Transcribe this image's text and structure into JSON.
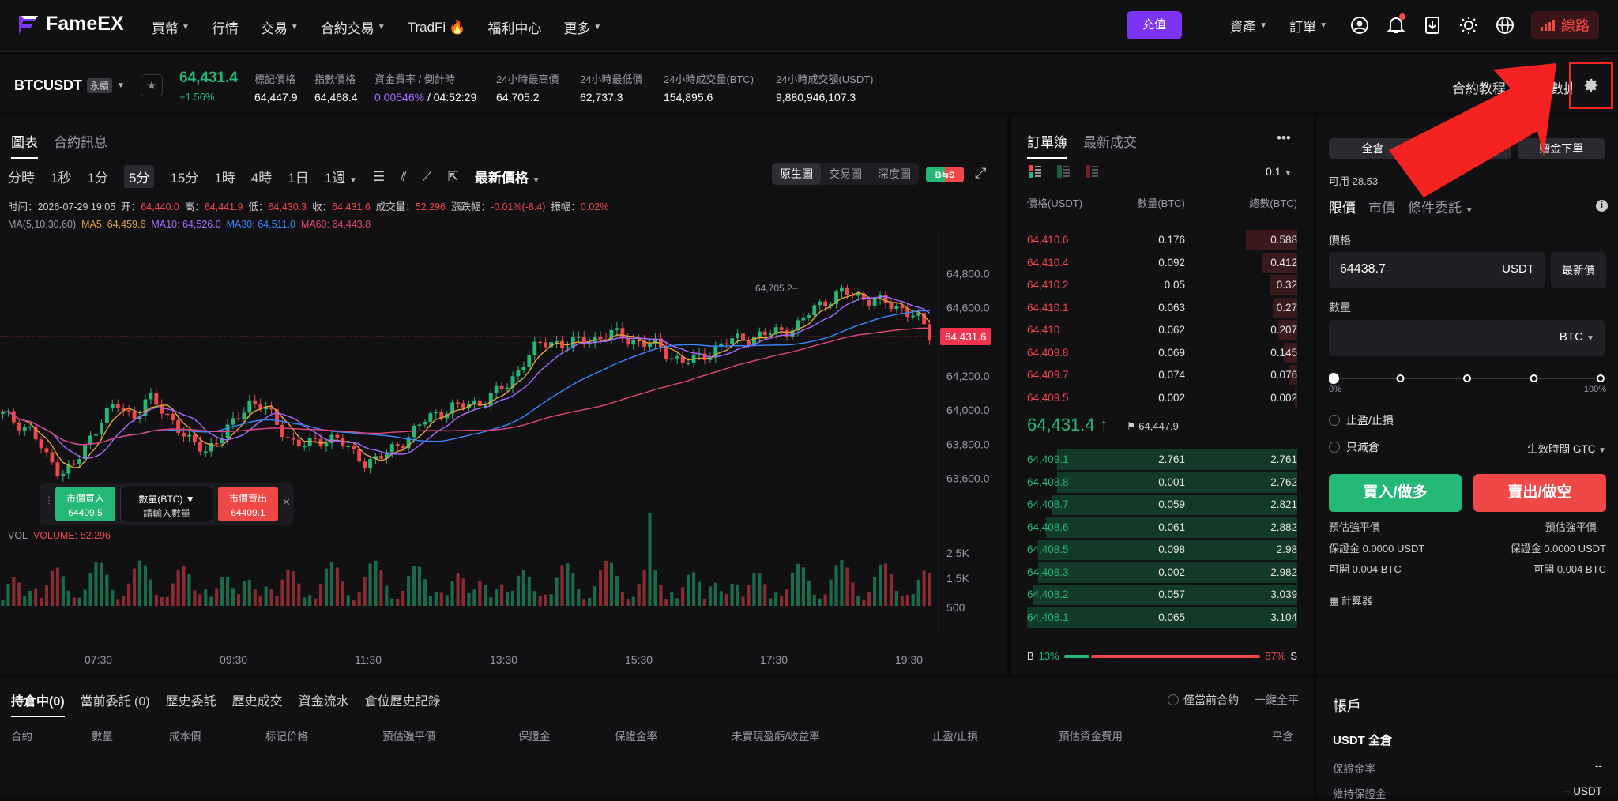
{
  "brand": {
    "name": "FameEX"
  },
  "nav": {
    "items": [
      "買幣",
      "行情",
      "交易",
      "合約交易",
      "TradFi",
      "福利中心",
      "更多"
    ]
  },
  "topbar": {
    "deposit": "充值",
    "assets": "資產",
    "orders": "訂單",
    "route": "線路"
  },
  "ticker": {
    "symbol": "BTCUSDT",
    "tag": "永續",
    "last": "64,431.4",
    "change": "+1.56%",
    "stats": [
      {
        "label": "標記價格",
        "value": "64,447.9"
      },
      {
        "label": "指數價格",
        "value": "64,468.4"
      },
      {
        "label": "資金費率 / 倒計時",
        "value_a": "0.00546%",
        "value_b": " / 04:52:29"
      },
      {
        "label": "24小時最高價",
        "value": "64,705.2"
      },
      {
        "label": "24小時最低價",
        "value": "62,737.3"
      },
      {
        "label": "24小時成交量(BTC)",
        "value": "154,895.6"
      },
      {
        "label": "24小時成交額(USDT)",
        "value": "9,880,946,107.3"
      }
    ],
    "right_links": [
      "合約教程",
      "合約數據"
    ]
  },
  "chart_panel": {
    "tabs": [
      "圖表",
      "合約訊息"
    ],
    "intervals": [
      "分時",
      "1秒",
      "1分",
      "5分",
      "15分",
      "1時",
      "4時",
      "1日",
      "1週"
    ],
    "price_type": "最新價格",
    "views": [
      "原生圖",
      "交易圖",
      "深度圖"
    ],
    "bs_badge": "B⇆S",
    "info": {
      "time_label": "时间：",
      "time": "2026-07-29 19:05",
      "open_label": "开：",
      "open": "64,440.0",
      "high_label": "高：",
      "high": "64,441.9",
      "low_label": "低：",
      "low": "64,430.3",
      "close_label": "收：",
      "close": "64,431.6",
      "vol_label": "成交量：",
      "vol": "52.296",
      "chg_label": "漲跌幅：",
      "chg": "-0.01%(-8.4)",
      "amp_label": "振幅：",
      "amp": "0.02%"
    },
    "ma": {
      "title": "MA(5,10,30,60)",
      "ma5": "MA5: 64,459.6",
      "ma10": "MA10: 64,526.0",
      "ma30": "MA30: 64,511.0",
      "ma60": "MA60: 64,443.8"
    },
    "vol_title": "VOL",
    "vol_value": "VOLUME: 52.296",
    "quick_trade": {
      "buy_label": "市價買入",
      "buy_price": "64409.5",
      "qty_label": "數量(BTC)",
      "qty_placeholder": "請輸入數量",
      "sell_label": "市價賣出",
      "sell_price": "64409.1"
    }
  },
  "chart_data": {
    "type": "candlestick",
    "x_ticks": [
      "07:30",
      "09:30",
      "11:30",
      "13:30",
      "15:30",
      "17:30",
      "19:30"
    ],
    "y_ticks": [
      64800.0,
      64600.0,
      64200.0,
      64000.0,
      63800.0,
      63600.0
    ],
    "y_tick_labels": [
      "64,800.0",
      "64,600.0",
      "64,200.0",
      "64,000.0",
      "63,800.0",
      "63,600.0"
    ],
    "ylim": [
      63500,
      64900
    ],
    "last_price": 64431.6,
    "last_price_label": "64,431.6",
    "high_marker": {
      "label": "64,705.2",
      "value": 64705.2
    },
    "close_path": [
      63970,
      63930,
      63880,
      63720,
      63640,
      63680,
      63820,
      63990,
      64020,
      63950,
      64080,
      63990,
      63920,
      63800,
      63760,
      63850,
      63920,
      64050,
      64030,
      63900,
      63820,
      63790,
      63820,
      63850,
      63750,
      63700,
      63720,
      63770,
      63850,
      63930,
      63980,
      64020,
      64020,
      64050,
      64100,
      64150,
      64300,
      64380,
      64400,
      64390,
      64400,
      64420,
      64450,
      64420,
      64400,
      64380,
      64330,
      64280,
      64300,
      64350,
      64400,
      64420,
      64430,
      64450,
      64470,
      64500,
      64600,
      64650,
      64690,
      64670,
      64650,
      64620,
      64600,
      64560,
      64431
    ],
    "vol_ticks": [
      "2.5K",
      "1.5K",
      "500"
    ]
  },
  "orderbook": {
    "tabs": [
      "訂單簿",
      "最新成交"
    ],
    "precision": "0.1",
    "headers": [
      "價格(USDT)",
      "數量(BTC)",
      "總數(BTC)"
    ],
    "asks": [
      {
        "p": "64,410.6",
        "a": "0.176",
        "t": "0.588",
        "d": 0.19
      },
      {
        "p": "64,410.4",
        "a": "0.092",
        "t": "0.412",
        "d": 0.13
      },
      {
        "p": "64,410.2",
        "a": "0.05",
        "t": "0.32",
        "d": 0.1
      },
      {
        "p": "64,410.1",
        "a": "0.063",
        "t": "0.27",
        "d": 0.09
      },
      {
        "p": "64,410",
        "a": "0.062",
        "t": "0.207",
        "d": 0.07
      },
      {
        "p": "64,409.8",
        "a": "0.069",
        "t": "0.145",
        "d": 0.05
      },
      {
        "p": "64,409.7",
        "a": "0.074",
        "t": "0.076",
        "d": 0.03
      },
      {
        "p": "64,409.5",
        "a": "0.002",
        "t": "0.002",
        "d": 0.01
      }
    ],
    "mid": "64,431.4 ↑",
    "mark": "64,447.9",
    "bids": [
      {
        "p": "64,409.1",
        "a": "2.761",
        "t": "2.761",
        "d": 0.89
      },
      {
        "p": "64,408.8",
        "a": "0.001",
        "t": "2.762",
        "d": 0.89
      },
      {
        "p": "64,408.7",
        "a": "0.059",
        "t": "2.821",
        "d": 0.91
      },
      {
        "p": "64,408.6",
        "a": "0.061",
        "t": "2.882",
        "d": 0.93
      },
      {
        "p": "64,408.5",
        "a": "0.098",
        "t": "2.98",
        "d": 0.96
      },
      {
        "p": "64,408.3",
        "a": "0.002",
        "t": "2.982",
        "d": 0.96
      },
      {
        "p": "64,408.2",
        "a": "0.057",
        "t": "3.039",
        "d": 0.98
      },
      {
        "p": "64,408.1",
        "a": "0.065",
        "t": "3.104",
        "d": 1.0
      }
    ],
    "ratio": {
      "b": "B",
      "b_pct": "13%",
      "s_pct": "87%",
      "s": "S",
      "buy_fraction": 0.13
    }
  },
  "order_panel": {
    "modes": [
      "全倉",
      "",
      "贈金下單"
    ],
    "available": "可用 28.53",
    "tabs": [
      "限價",
      "市價",
      "條件委託"
    ],
    "price_label": "價格",
    "price_value": "64438.7",
    "price_unit": "USDT",
    "latest_btn": "最新價",
    "qty_label": "數量",
    "qty_unit": "BTC",
    "slider_min": "0%",
    "slider_max": "100%",
    "slider_value": 0,
    "tpsl": "止盈/止損",
    "reduce_only": "只減倉",
    "tif": "生效時間 GTC",
    "buy_btn": "買入/做多",
    "sell_btn": "賣出/做空",
    "liq_l": "預估強平價 --",
    "liq_r": "預估強平價 --",
    "margin_l": "保證金 0.0000 USDT",
    "margin_r": "保證金 0.0000 USDT",
    "open_l": "可開 0.004 BTC",
    "open_r": "可開 0.004 BTC",
    "calculator": "計算器"
  },
  "positions": {
    "tabs": [
      "持倉中(0)",
      "當前委託 (0)",
      "歷史委託",
      "歷史成交",
      "資金流水",
      "倉位歷史記錄"
    ],
    "current_only": "僅當前合約",
    "close_all": "一鍵全平",
    "columns": [
      "合約",
      "數量",
      "成本價",
      "标记价格",
      "預估強平價",
      "保證金",
      "保證金率",
      "未實現盈虧/收益率",
      "止盈/止損",
      "預估資金費用",
      "平倉"
    ]
  },
  "account": {
    "title": "帳戶",
    "subtitle": "USDT 全倉",
    "margin_rate": "保證金率",
    "margin_rate_val": "--",
    "maint": "維持保證金",
    "maint_val": "-- USDT"
  },
  "colors": {
    "up": "#24b876",
    "down": "#f04747",
    "accent": "#7b34f5",
    "highlight": "#f52222"
  }
}
